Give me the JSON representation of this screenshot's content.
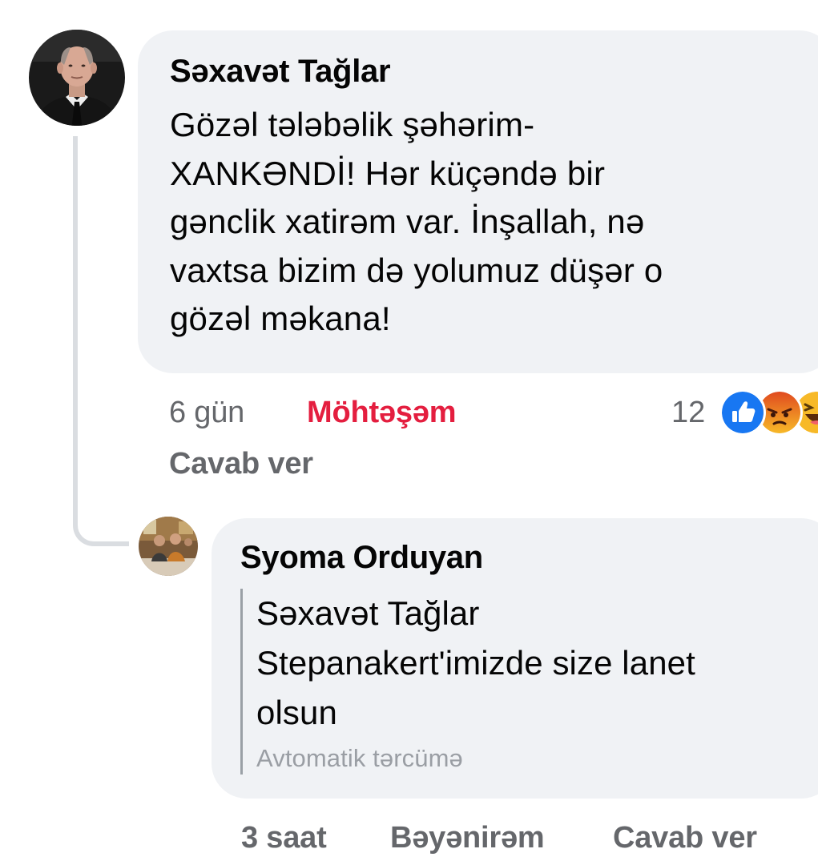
{
  "main_comment": {
    "author": "Səxavət Tağlar",
    "avatar_icon": "profile-photo-man-in-suit",
    "lines": [
      "Gözəl tələbəlik şəhərim-",
      "XANKƏNDİ! Hər küçəndə bir",
      "gənclik xatirəm var. İnşallah, nə",
      "vaxtsa bizim də yolumuz düşər o",
      "gözəl məkana!"
    ],
    "time": "6 gün",
    "reaction_label": "Möhtəşəm",
    "reaction_label_color": "#e41e3f",
    "reply_label": "Cavab ver",
    "reaction_count": "12",
    "reaction_icons": [
      "like-icon",
      "angry-icon",
      "haha-icon"
    ]
  },
  "reply_comment": {
    "author": "Syoma Orduyan",
    "avatar_icon": "profile-photo-group",
    "quote_lines": [
      "Səxavət Tağlar",
      "Stepanakert'imizde size lanet",
      "olsun"
    ],
    "auto_translate_label": "Avtomatik tərcümə",
    "time": "3 saat",
    "like_label": "Bəyənirəm",
    "reply_label": "Cavab ver"
  },
  "colors": {
    "bubble_background": "#f0f2f5",
    "secondary_text": "#65676b",
    "thread_line": "#dadde1",
    "like_blue": "#1877f2",
    "angry_orange": "#e8632b",
    "haha_yellow": "#f7b928"
  }
}
